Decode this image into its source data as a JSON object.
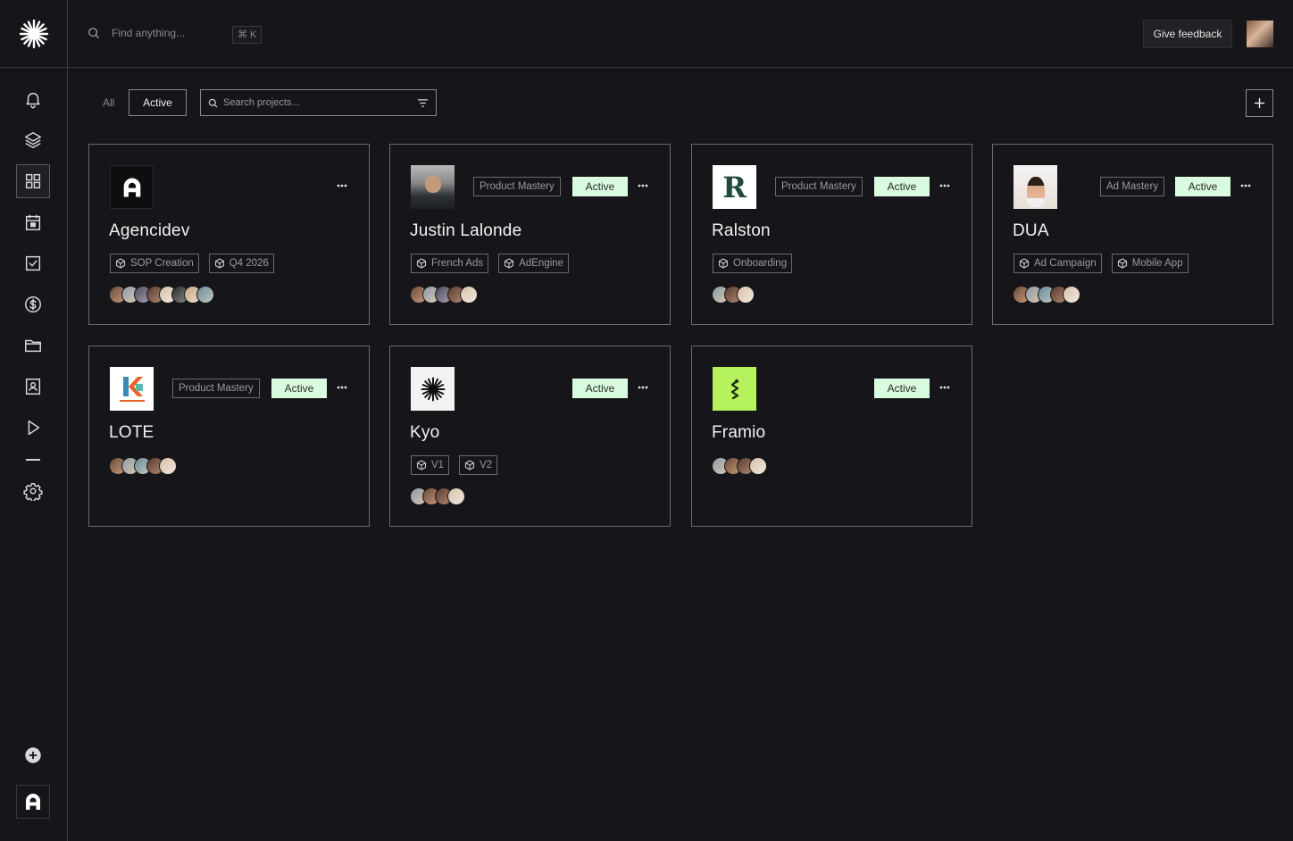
{
  "topbar": {
    "search_placeholder": "Find anything...",
    "shortcut": "⌘ K",
    "feedback_label": "Give feedback"
  },
  "filters": {
    "all_label": "All",
    "active_label": "Active",
    "search_placeholder": "Search projects..."
  },
  "colors": {
    "background": "#16161a",
    "active_badge": "#d9fbdf",
    "border": "#6a6a6e"
  },
  "sidebar": {
    "items": [
      {
        "icon": "bell-icon"
      },
      {
        "icon": "layers-icon"
      },
      {
        "icon": "grid-icon",
        "active": true
      },
      {
        "icon": "calendar-icon"
      },
      {
        "icon": "checkbox-icon"
      },
      {
        "icon": "dollar-icon"
      },
      {
        "icon": "folder-icon"
      },
      {
        "icon": "contact-icon"
      },
      {
        "icon": "play-icon"
      },
      {
        "icon": "settings-icon"
      },
      {
        "icon": "add-circle-icon"
      }
    ]
  },
  "projects": [
    {
      "name": "Agencidev",
      "category": "",
      "status": "",
      "tags": [
        "SOP Creation",
        "Q4 2026"
      ],
      "members": 8
    },
    {
      "name": "Justin Lalonde",
      "category": "Product Mastery",
      "status": "Active",
      "tags": [
        "French Ads",
        "AdEngine"
      ],
      "members": 5
    },
    {
      "name": "Ralston",
      "category": "Product Mastery",
      "status": "Active",
      "tags": [
        "Onboarding"
      ],
      "members": 3
    },
    {
      "name": "DUA",
      "category": "Ad Mastery",
      "status": "Active",
      "tags": [
        "Ad Campaign",
        "Mobile App"
      ],
      "members": 5
    },
    {
      "name": "LOTE",
      "category": "Product Mastery",
      "status": "Active",
      "tags": [],
      "members": 5
    },
    {
      "name": "Kyo",
      "category": "",
      "status": "Active",
      "tags": [
        "V1",
        "V2"
      ],
      "members": 4
    },
    {
      "name": "Framio",
      "category": "",
      "status": "Active",
      "tags": [],
      "members": 4
    }
  ]
}
